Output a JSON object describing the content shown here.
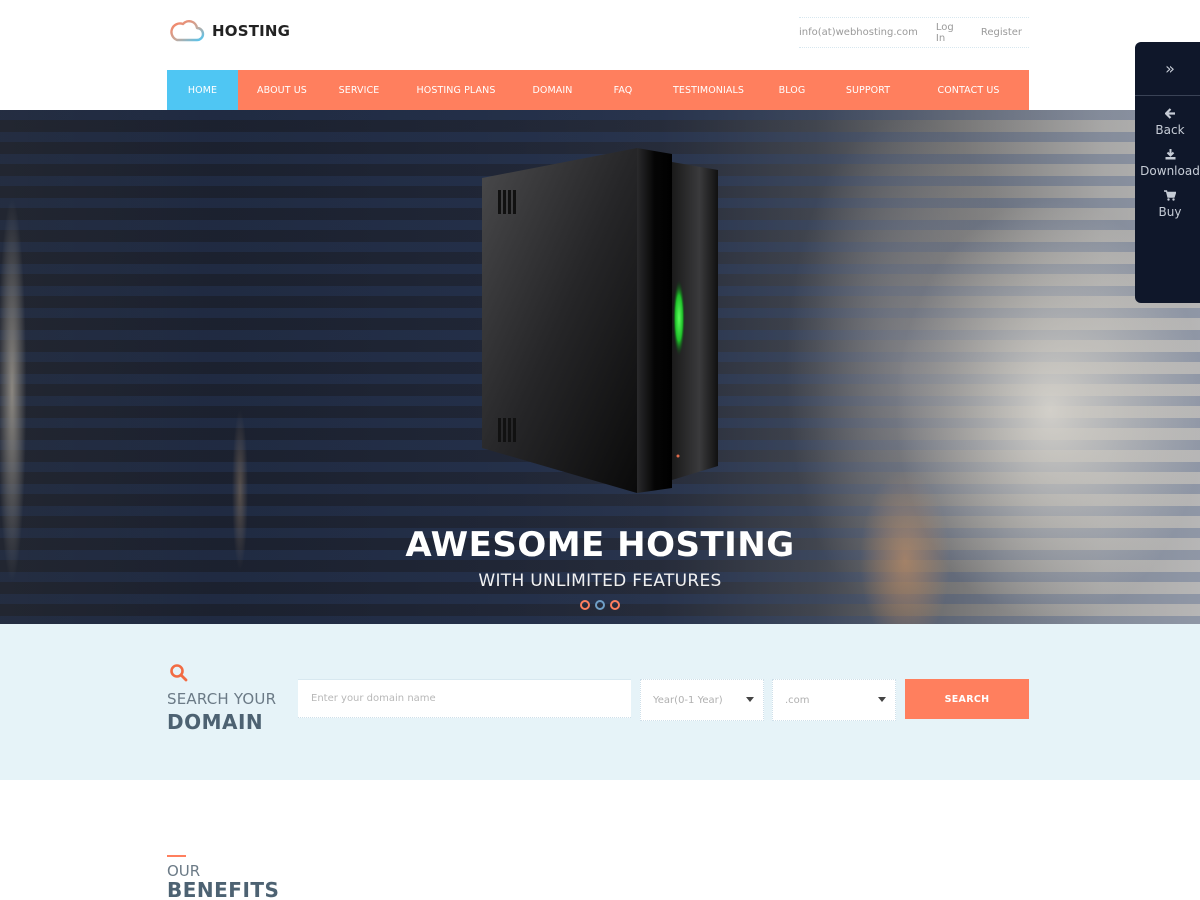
{
  "brand": {
    "name": "HOSTING",
    "accent": "#ff7f5e",
    "active_nav": "#4fc6f3"
  },
  "toplinks": [
    {
      "label": "info(at)webhosting.com"
    },
    {
      "label": "Log In"
    },
    {
      "label": "Register"
    }
  ],
  "nav": {
    "items": [
      {
        "label": "HOME",
        "active": true
      },
      {
        "label": "ABOUT US"
      },
      {
        "label": "SERVICE"
      },
      {
        "label": "HOSTING PLANS"
      },
      {
        "label": "DOMAIN"
      },
      {
        "label": "FAQ"
      },
      {
        "label": "TESTIMONIALS"
      },
      {
        "label": "BLOG"
      },
      {
        "label": "SUPPORT"
      },
      {
        "label": "CONTACT US"
      }
    ]
  },
  "hero": {
    "title": "AWESOME HOSTING",
    "subtitle": "WITH UNLIMITED FEATURES",
    "slides": 3,
    "active_slide": 2
  },
  "side_panel": {
    "toggle_icon": "»",
    "items": [
      {
        "icon": "🡐",
        "label": "Back"
      },
      {
        "icon": "⤓",
        "label": "Download"
      },
      {
        "icon": "🛒",
        "label": "Buy"
      }
    ]
  },
  "search": {
    "label_top": "SEARCH YOUR",
    "label_bottom": "DOMAIN",
    "placeholder": "Enter your domain name",
    "years_selected": "Year(0-1 Year)",
    "tld_selected": ".com",
    "button": "SEARCH"
  },
  "benefits": {
    "line1": "OUR",
    "line2": "BENEFITS"
  }
}
